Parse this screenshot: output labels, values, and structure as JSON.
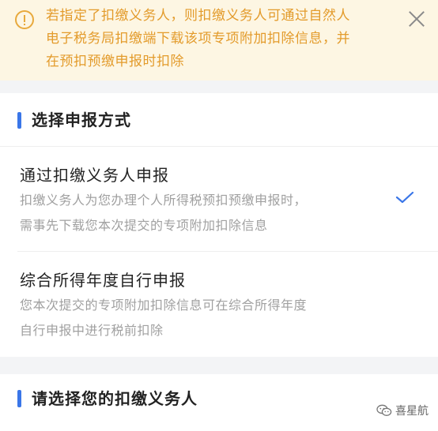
{
  "notice": {
    "lines": [
      "若指定了扣缴义务人，则扣缴义务人可通过自然人",
      "电子税务局扣缴端下载该项专项附加扣除信息，并",
      "在预扣预缴申报时扣除"
    ],
    "icon": "warning-circle-icon",
    "close_icon": "close-icon",
    "color": "#e39b2b"
  },
  "declare_section": {
    "title": "选择申报方式",
    "options": [
      {
        "title": "通过扣缴义务人申报",
        "desc_lines": [
          "扣缴义务人为您办理个人所得税预扣预缴申报时，",
          "需事先下载您本次提交的专项附加扣除信息"
        ],
        "selected": true
      },
      {
        "title": "综合所得年度自行申报",
        "desc_lines": [
          "您本次提交的专项附加扣除信息可在综合所得年度",
          "自行申报中进行税前扣除"
        ],
        "selected": false
      }
    ]
  },
  "withholder_section": {
    "title": "请选择您的扣缴义务人"
  },
  "watermark": {
    "text": "喜星航",
    "icon": "wechat-icon"
  },
  "colors": {
    "accent": "#3a76e8",
    "notice_bg": "#fdf6e3",
    "muted_text": "#a0a0a0"
  }
}
